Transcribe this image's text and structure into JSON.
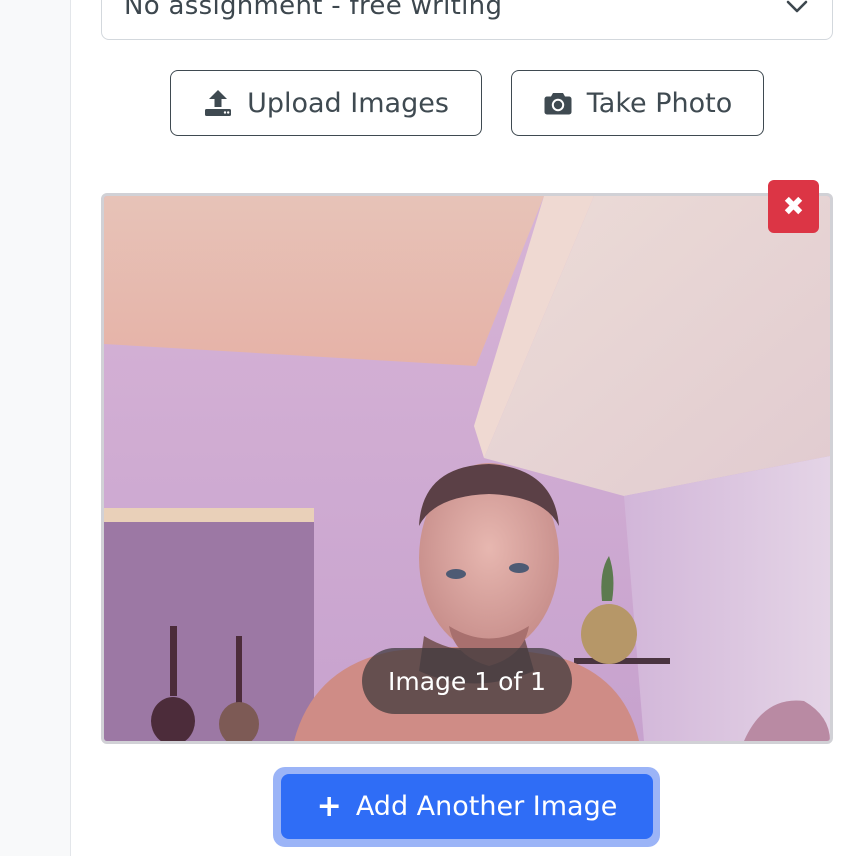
{
  "assignment_select": {
    "selected_value": "No assignment - free writing",
    "chevron_icon": "chevron-down-icon"
  },
  "actions": {
    "upload_label": "Upload Images",
    "upload_icon": "upload-icon",
    "photo_label": "Take Photo",
    "photo_icon": "camera-icon"
  },
  "preview": {
    "remove_icon": "close-icon",
    "remove_symbol": "✖",
    "counter_text": "Image 1 of 1"
  },
  "add_button": {
    "plus_symbol": "+",
    "label": "Add Another Image"
  },
  "colors": {
    "danger": "#dc3545",
    "primary": "#2f6df6",
    "outline": "#3f4a51"
  }
}
